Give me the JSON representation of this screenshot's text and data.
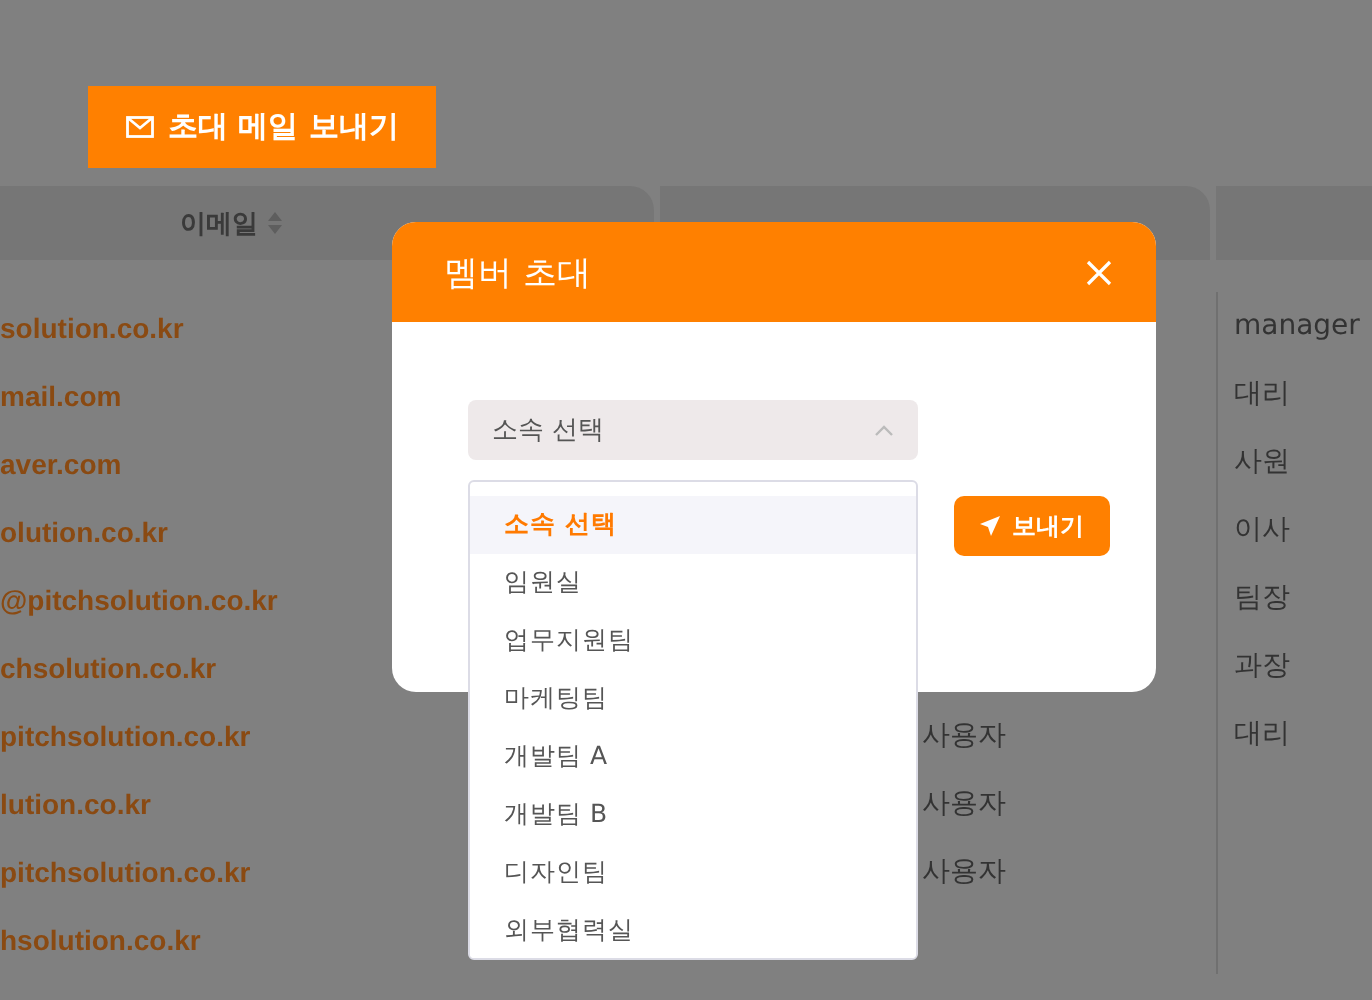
{
  "invite_button": {
    "label": "초대 메일 보내기"
  },
  "table": {
    "columns": [
      {
        "label": "이메일"
      }
    ],
    "email_rows": [
      "solution.co.kr",
      "mail.com",
      "aver.com",
      "olution.co.kr",
      "@pitchsolution.co.kr",
      "chsolution.co.kr",
      "pitchsolution.co.kr",
      "lution.co.kr",
      "pitchsolution.co.kr",
      "hsolution.co.kr"
    ],
    "role_rows": [
      "사용자",
      "사용자",
      "사용자"
    ],
    "position_rows": [
      "manager",
      "대리",
      "사원",
      "이사",
      "팀장",
      "과장",
      "대리"
    ]
  },
  "modal": {
    "title": "멤버 초대",
    "select": {
      "value": "소속 선택",
      "expanded": true
    },
    "options": [
      {
        "label": "소속 선택",
        "selected": true
      },
      {
        "label": "임원실",
        "selected": false
      },
      {
        "label": "업무지원팀",
        "selected": false
      },
      {
        "label": "마케팅팀",
        "selected": false
      },
      {
        "label": "개발팀 A",
        "selected": false
      },
      {
        "label": "개발팀 B",
        "selected": false
      },
      {
        "label": "디자인팀",
        "selected": false
      },
      {
        "label": "외부협력실",
        "selected": false
      }
    ],
    "send_button": {
      "label": "보내기"
    }
  }
}
